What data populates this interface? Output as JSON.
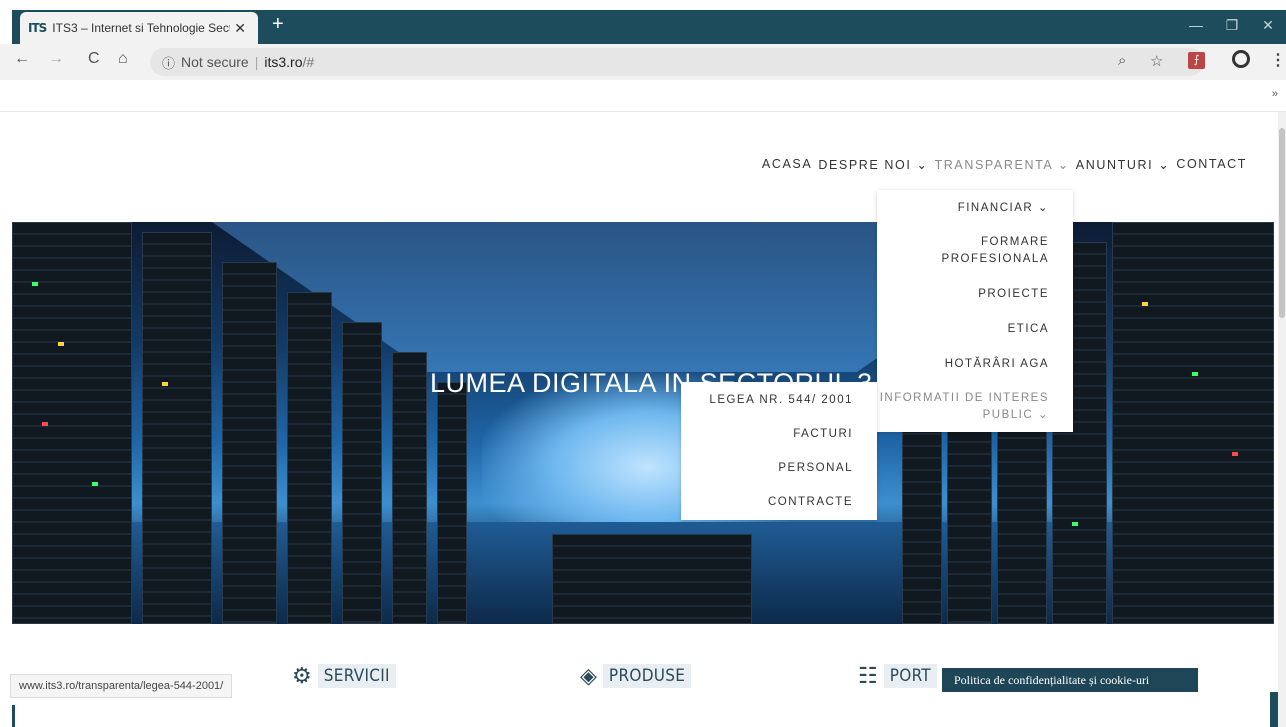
{
  "browser": {
    "tab_logo": "ITS",
    "tab_title": "ITS3 – Internet si Tehnologie Sect",
    "tab_close": "✕",
    "new_tab": "+",
    "window_controls": {
      "minimize": "—",
      "restore": "❐",
      "close": "✕"
    },
    "nav": {
      "back": "←",
      "forward": "→",
      "reload": "C",
      "home": "⌂"
    },
    "address": {
      "info_icon": "ⓘ",
      "security_text": "Not secure",
      "separator": "|",
      "host": "its3.ro",
      "path": "/#"
    },
    "toolbar_icons": {
      "zoom": "search-icon",
      "star": "star-icon",
      "pdf": "pdf-extension-icon",
      "profile": "account-icon",
      "menu": "more-icon"
    },
    "bookmarks_overflow": "»"
  },
  "nav": {
    "items": [
      {
        "label": "ACASA"
      },
      {
        "label": "DESPRE NOI ⌄"
      },
      {
        "label": "TRANSPARENTA ⌄"
      },
      {
        "label": "ANUNTURI ⌄"
      },
      {
        "label": "CONTACT"
      }
    ]
  },
  "hero": {
    "title": "LUMEA DIGITALA IN SECTORUL 3"
  },
  "dropdown": {
    "items": [
      {
        "label": "FINANCIAR ⌄"
      },
      {
        "label": "FORMARE"
      },
      {
        "label": "PROFESIONALA"
      },
      {
        "label": "PROIECTE"
      },
      {
        "label": "ETICA"
      },
      {
        "label": "HOTĂRÂRI AGA"
      },
      {
        "label": "INFORMATII DE INTERES"
      },
      {
        "label": "PUBLIC ⌄"
      }
    ]
  },
  "submenu": {
    "items": [
      {
        "label": "LEGEA NR. 544/ 2001"
      },
      {
        "label": "FACTURI"
      },
      {
        "label": "PERSONAL"
      },
      {
        "label": "CONTRACTE"
      }
    ]
  },
  "features": [
    {
      "label": "SERVICII",
      "icon": "gears-icon"
    },
    {
      "label": "PRODUSE",
      "icon": "layers-icon"
    },
    {
      "label": "PORT",
      "icon": "network-icon"
    }
  ],
  "status_bar": {
    "url": "www.its3.ro/transparenta/legea-544-2001/"
  },
  "cookie_banner": {
    "text": "Politica de confidențialitate și cookie-uri"
  }
}
